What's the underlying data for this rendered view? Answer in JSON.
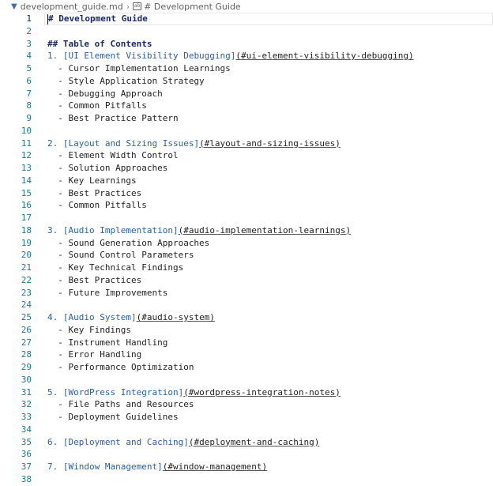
{
  "breadcrumb": {
    "file": "development_guide.md",
    "section": "# Development Guide"
  },
  "lines": [
    {
      "n": "1",
      "kind": "h1",
      "text": "# Development Guide"
    },
    {
      "n": "2",
      "kind": "blank"
    },
    {
      "n": "3",
      "kind": "h2",
      "text": "## Table of Contents"
    },
    {
      "n": "4",
      "kind": "toc",
      "num": "1.",
      "label": "[UI Element Visibility Debugging]",
      "url": "(#ui-element-visibility-debugging)"
    },
    {
      "n": "5",
      "kind": "item",
      "text": "- Cursor Implementation Learnings"
    },
    {
      "n": "6",
      "kind": "item",
      "text": "- Style Application Strategy"
    },
    {
      "n": "7",
      "kind": "item",
      "text": "- Debugging Approach"
    },
    {
      "n": "8",
      "kind": "item",
      "text": "- Common Pitfalls"
    },
    {
      "n": "9",
      "kind": "item",
      "text": "- Best Practice Pattern"
    },
    {
      "n": "10",
      "kind": "blank"
    },
    {
      "n": "11",
      "kind": "toc",
      "num": "2.",
      "label": "[Layout and Sizing Issues]",
      "url": "(#layout-and-sizing-issues)"
    },
    {
      "n": "12",
      "kind": "item",
      "text": "- Element Width Control"
    },
    {
      "n": "13",
      "kind": "item",
      "text": "- Solution Approaches"
    },
    {
      "n": "14",
      "kind": "item",
      "text": "- Key Learnings"
    },
    {
      "n": "15",
      "kind": "item",
      "text": "- Best Practices"
    },
    {
      "n": "16",
      "kind": "item",
      "text": "- Common Pitfalls"
    },
    {
      "n": "17",
      "kind": "blank"
    },
    {
      "n": "18",
      "kind": "toc",
      "num": "3.",
      "label": "[Audio Implementation]",
      "url": "(#audio-implementation-learnings)"
    },
    {
      "n": "19",
      "kind": "item",
      "text": "- Sound Generation Approaches"
    },
    {
      "n": "20",
      "kind": "item",
      "text": "- Sound Control Parameters"
    },
    {
      "n": "21",
      "kind": "item",
      "text": "- Key Technical Findings"
    },
    {
      "n": "22",
      "kind": "item",
      "text": "- Best Practices"
    },
    {
      "n": "23",
      "kind": "item",
      "text": "- Future Improvements"
    },
    {
      "n": "24",
      "kind": "blank"
    },
    {
      "n": "25",
      "kind": "toc",
      "num": "4.",
      "label": "[Audio System]",
      "url": "(#audio-system)"
    },
    {
      "n": "26",
      "kind": "item",
      "text": "- Key Findings"
    },
    {
      "n": "27",
      "kind": "item",
      "text": "- Instrument Handling"
    },
    {
      "n": "28",
      "kind": "item",
      "text": "- Error Handling"
    },
    {
      "n": "29",
      "kind": "item",
      "text": "- Performance Optimization"
    },
    {
      "n": "30",
      "kind": "blank"
    },
    {
      "n": "31",
      "kind": "toc",
      "num": "5.",
      "label": "[WordPress Integration]",
      "url": "(#wordpress-integration-notes)"
    },
    {
      "n": "32",
      "kind": "item",
      "text": "- File Paths and Resources"
    },
    {
      "n": "33",
      "kind": "item",
      "text": "- Deployment Guidelines"
    },
    {
      "n": "34",
      "kind": "blank"
    },
    {
      "n": "35",
      "kind": "toc",
      "num": "6.",
      "label": "[Deployment and Caching]",
      "url": "(#deployment-and-caching)"
    },
    {
      "n": "36",
      "kind": "blank"
    },
    {
      "n": "37",
      "kind": "toc",
      "num": "7.",
      "label": "[Window Management]",
      "url": "(#window-management)"
    },
    {
      "n": "38",
      "kind": "blank"
    }
  ]
}
